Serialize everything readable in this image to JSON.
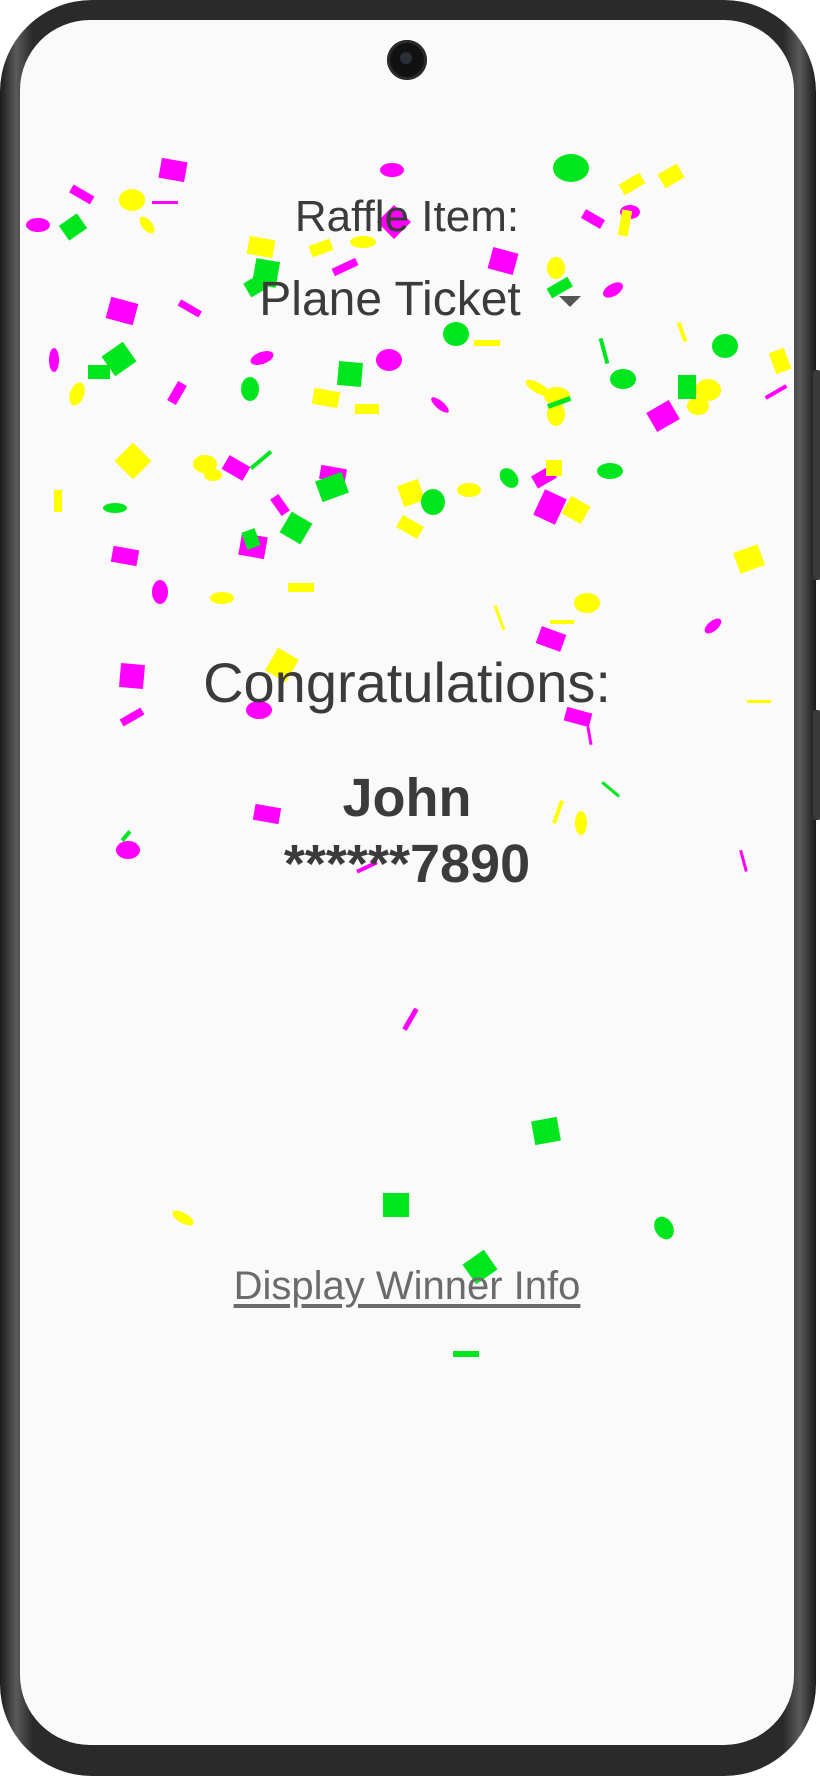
{
  "raffle": {
    "label": "Raffle Item:",
    "selected_item": "Plane Ticket"
  },
  "result": {
    "heading": "Congratulations:",
    "winner_name": "John",
    "winner_phone": "******7890"
  },
  "actions": {
    "display_winner_info": "Display Winner Info"
  },
  "colors": {
    "background": "#fafafa",
    "text": "#3b3b3b",
    "link": "#6b6b6b",
    "confetti_magenta": "#ff00ff",
    "confetti_yellow": "#ffff00",
    "confetti_green": "#00e61e"
  }
}
